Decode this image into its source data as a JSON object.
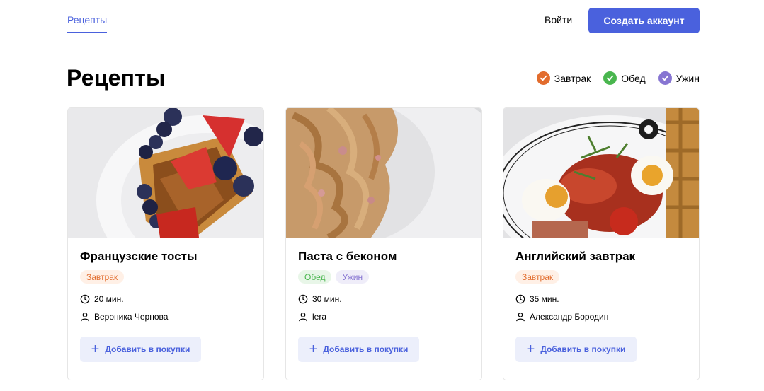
{
  "nav": {
    "recipes_link": "Рецепты",
    "login": "Войти",
    "signup": "Создать аккаунт"
  },
  "page": {
    "title": "Рецепты"
  },
  "filters": [
    {
      "label": "Завтрак",
      "color": "#E26C2D"
    },
    {
      "label": "Обед",
      "color": "#49B64E"
    },
    {
      "label": "Ужин",
      "color": "#8775D2"
    }
  ],
  "cards": [
    {
      "title": "Французские тосты",
      "tags": [
        {
          "label": "Завтрак",
          "color": "#E26C2D",
          "bg": "#FFF0E6"
        }
      ],
      "time": "20 мин.",
      "author": "Вероника Чернова",
      "add_label": "Добавить в покупки"
    },
    {
      "title": "Паста с беконом",
      "tags": [
        {
          "label": "Обед",
          "color": "#49B64E",
          "bg": "#E8F6E8"
        },
        {
          "label": "Ужин",
          "color": "#8775D2",
          "bg": "#EFEDF9"
        }
      ],
      "time": "30 мин.",
      "author": "lera",
      "add_label": "Добавить в покупки"
    },
    {
      "title": "Английский завтрак",
      "tags": [
        {
          "label": "Завтрак",
          "color": "#E26C2D",
          "bg": "#FFF0E6"
        }
      ],
      "time": "35 мин.",
      "author": "Александр Бородин",
      "add_label": "Добавить в покупки"
    }
  ]
}
